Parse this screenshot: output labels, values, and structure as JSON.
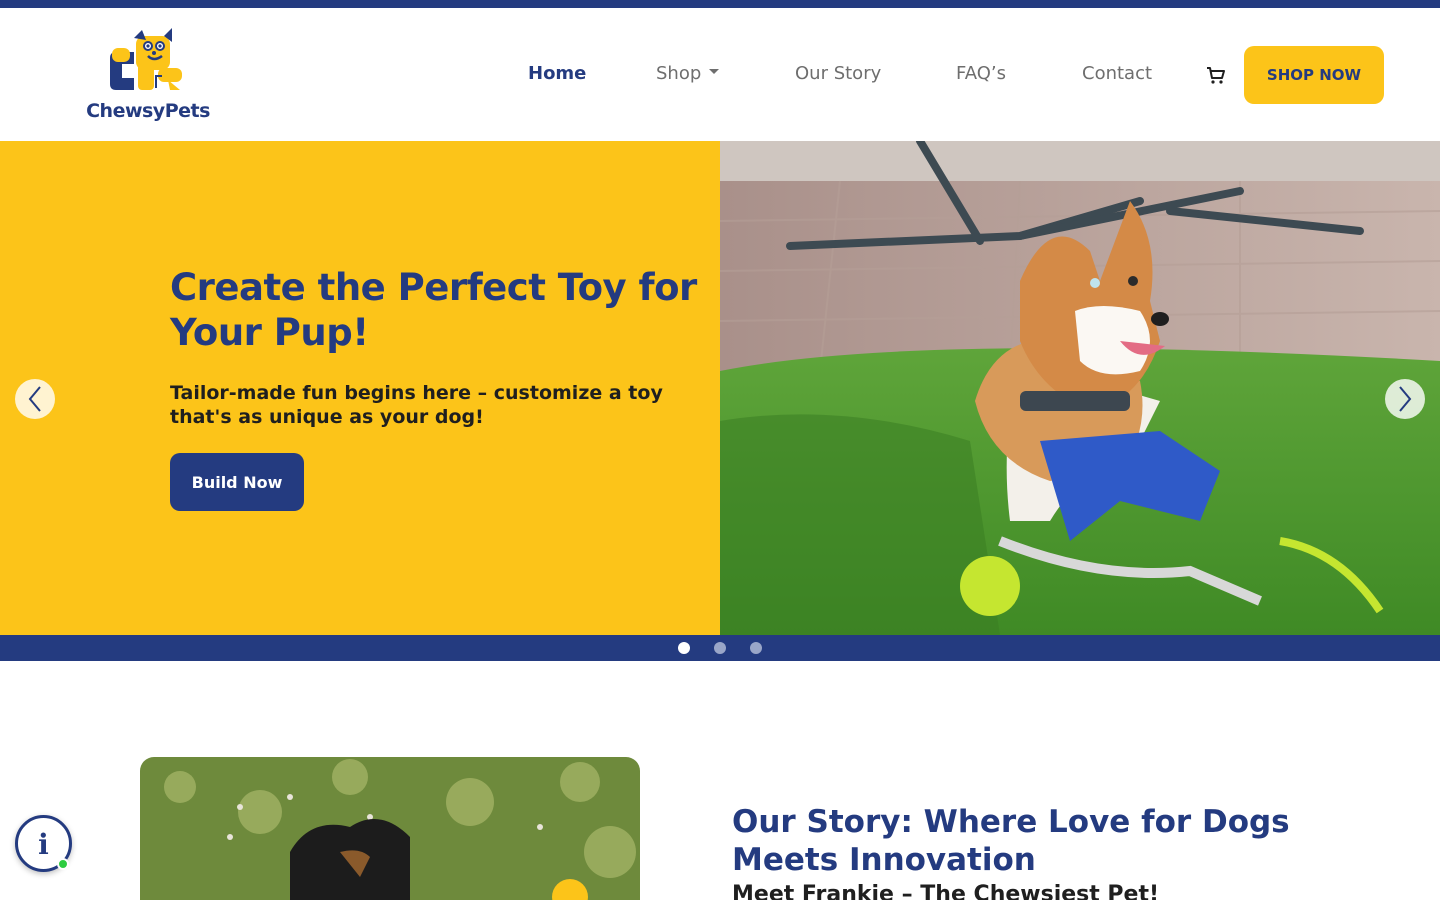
{
  "brand": {
    "name": "ChewsyPets"
  },
  "colors": {
    "primary": "#243b80",
    "accent": "#fcc419"
  },
  "nav": {
    "items": [
      {
        "label": "Home",
        "active": true
      },
      {
        "label": "Shop",
        "has_dropdown": true
      },
      {
        "label": "Our Story"
      },
      {
        "label": "FAQ’s"
      },
      {
        "label": "Contact"
      }
    ],
    "cart_icon": "cart-icon",
    "cta_label": "SHOP NOW"
  },
  "hero": {
    "title": "Create the Perfect Toy for Your Pup!",
    "subtitle": "Tailor-made fun begins here – customize a toy that's as unique as your dog!",
    "button_label": "Build Now",
    "prev_icon": "chevron-left-icon",
    "next_icon": "chevron-right-icon",
    "slides_count": 3,
    "active_slide": 1
  },
  "story": {
    "title": "Our Story: Where Love for Dogs Meets Innovation",
    "subtitle": "Meet Frankie – The Chewsiest Pet!"
  },
  "widget": {
    "icon": "info-icon",
    "label": "i"
  }
}
